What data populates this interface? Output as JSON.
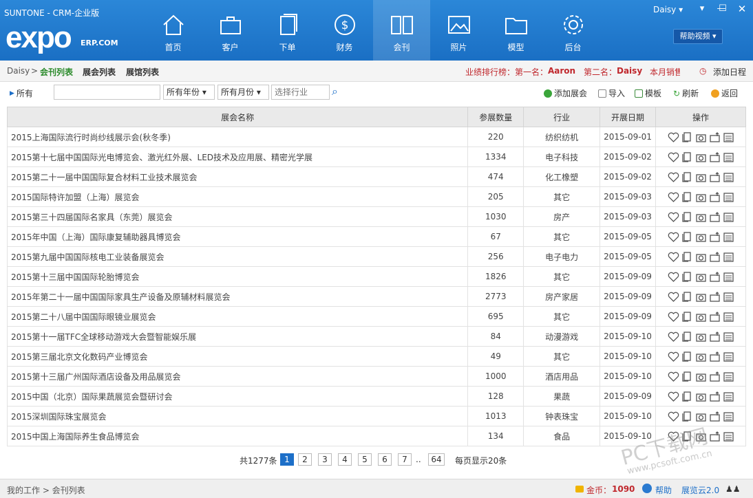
{
  "app": {
    "title": "SUNTONE - CRM-企业版",
    "logo": "expo",
    "logo_sub": "ERP.COM",
    "user": "Daisy ▾",
    "help_video": "帮助视频 ▾"
  },
  "nav": [
    {
      "label": "首页",
      "icon": "home-icon"
    },
    {
      "label": "客户",
      "icon": "briefcase-icon"
    },
    {
      "label": "下单",
      "icon": "document-icon"
    },
    {
      "label": "财务",
      "icon": "dollar-icon"
    },
    {
      "label": "会刊",
      "icon": "book-icon",
      "active": true
    },
    {
      "label": "照片",
      "icon": "picture-icon"
    },
    {
      "label": "模型",
      "icon": "folder-icon"
    },
    {
      "label": "后台",
      "icon": "gear-icon"
    }
  ],
  "breadcrumb": {
    "root": "Daisy",
    "sep": ">",
    "current": "会刊列表",
    "links": [
      "展会列表",
      "展馆列表"
    ],
    "ranking": "业绩排行榜：第一名：",
    "first": "Aaron",
    "second_label": "第二名：",
    "second": "Daisy",
    "month": "本月销售",
    "add_schedule": "添加日程"
  },
  "toolbar": {
    "all": "所有",
    "year": "所有年份",
    "month": "所有月份",
    "industry_placeholder": "选择行业",
    "add": "添加展会",
    "import": "导入",
    "template": "模板",
    "refresh": "刷新",
    "back": "返回"
  },
  "table": {
    "headers": [
      "展会名称",
      "参展数量",
      "行业",
      "开展日期",
      "操作"
    ],
    "rows": [
      [
        "2015上海国际流行时尚纱线展示会(秋冬季)",
        "220",
        "纺织纺机",
        "2015-09-01"
      ],
      [
        "2015第十七届中国国际光电博览会、激光红外展、LED技术及应用展、精密光学展",
        "1334",
        "电子科技",
        "2015-09-02"
      ],
      [
        "2015第二十一届中国国际复合材料工业技术展览会",
        "474",
        "化工橡塑",
        "2015-09-02"
      ],
      [
        "2015国际特许加盟（上海）展览会",
        "205",
        "其它",
        "2015-09-03"
      ],
      [
        "2015第三十四届国际名家具（东莞）展览会",
        "1030",
        "房产",
        "2015-09-03"
      ],
      [
        "2015年中国（上海）国际康复辅助器具博览会",
        "67",
        "其它",
        "2015-09-05"
      ],
      [
        "2015第九届中国国际核电工业装备展览会",
        "256",
        "电子电力",
        "2015-09-05"
      ],
      [
        "2015第十三届中国国际轮胎博览会",
        "1826",
        "其它",
        "2015-09-09"
      ],
      [
        "2015年第二十一届中国国际家具生产设备及原辅材料展览会",
        "2773",
        "房产家居",
        "2015-09-09"
      ],
      [
        "2015第二十八届中国国际眼镜业展览会",
        "695",
        "其它",
        "2015-09-09"
      ],
      [
        "2015第十一届TFC全球移动游戏大会暨智能娱乐展",
        "84",
        "动漫游戏",
        "2015-09-10"
      ],
      [
        "2015第三届北京文化数码产业博览会",
        "49",
        "其它",
        "2015-09-10"
      ],
      [
        "2015第十三届广州国际酒店设备及用品展览会",
        "1000",
        "酒店用品",
        "2015-09-10"
      ],
      [
        "2015中国（北京）国际果蔬展览会暨研讨会",
        "128",
        "果蔬",
        "2015-09-09"
      ],
      [
        "2015深圳国际珠宝展览会",
        "1013",
        "钟表珠宝",
        "2015-09-10"
      ],
      [
        "2015中国上海国际养生食品博览会",
        "134",
        "食品",
        "2015-09-10"
      ]
    ]
  },
  "pager": {
    "total": "共1277条",
    "pages": [
      "1",
      "2",
      "3",
      "4",
      "5",
      "6",
      "7",
      "..",
      "64"
    ],
    "per_page": "每页显示20条"
  },
  "status": {
    "path": "我的工作 > 会刊列表",
    "coins_label": "金币：",
    "coins": "1090",
    "help": "帮助",
    "cloud": "展览云2.0"
  },
  "watermark": {
    "main": "PC下载网",
    "url": "www.pcsoft.com.cn"
  }
}
